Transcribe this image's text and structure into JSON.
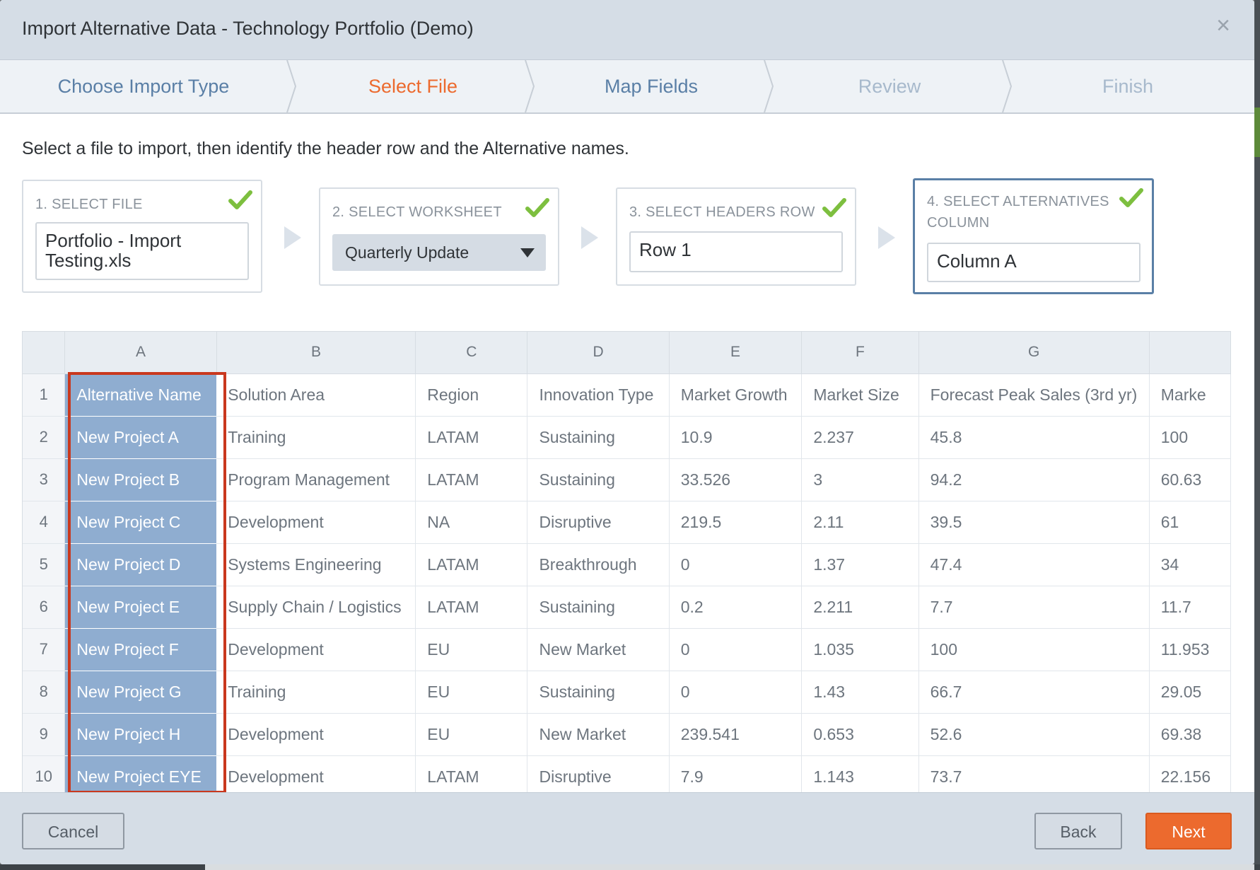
{
  "dialog": {
    "title": "Import Alternative Data - Technology Portfolio (Demo)",
    "close_glyph": "×"
  },
  "steps": [
    {
      "label": "Choose Import Type",
      "state": "done"
    },
    {
      "label": "Select File",
      "state": "active"
    },
    {
      "label": "Map Fields",
      "state": "upcoming"
    },
    {
      "label": "Review",
      "state": "disabled"
    },
    {
      "label": "Finish",
      "state": "disabled"
    }
  ],
  "instructions": "Select a file to import, then identify the header row and the Alternative names.",
  "cards": {
    "file": {
      "label": "1. SELECT FILE",
      "value": "Portfolio - Import Testing.xls"
    },
    "worksheet": {
      "label": "2. SELECT WORKSHEET",
      "value": "Quarterly Update"
    },
    "headers": {
      "label": "3. SELECT HEADERS ROW",
      "value": "Row 1"
    },
    "alternatives": {
      "label_line1": "4. SELECT ALTERNATIVES",
      "label_line2": "COLUMN",
      "value": "Column A"
    }
  },
  "grid": {
    "columns": [
      "A",
      "B",
      "C",
      "D",
      "E",
      "F",
      "G",
      ""
    ],
    "rows": [
      {
        "num": "1",
        "cells": [
          "Alternative Name",
          "Solution Area",
          "Region",
          "Innovation Type",
          "Market Growth",
          "Market Size",
          "Forecast Peak Sales (3rd yr)",
          "Marke"
        ]
      },
      {
        "num": "2",
        "cells": [
          "New Project A",
          "Training",
          "LATAM",
          "Sustaining",
          "10.9",
          "2.237",
          "45.8",
          "100"
        ]
      },
      {
        "num": "3",
        "cells": [
          "New Project B",
          "Program Management",
          "LATAM",
          "Sustaining",
          "33.526",
          "3",
          "94.2",
          "60.63"
        ]
      },
      {
        "num": "4",
        "cells": [
          "New Project C",
          "Development",
          "NA",
          "Disruptive",
          "219.5",
          "2.11",
          "39.5",
          "61"
        ]
      },
      {
        "num": "5",
        "cells": [
          "New Project D",
          "Systems Engineering",
          "LATAM",
          "Breakthrough",
          "0",
          "1.37",
          "47.4",
          "34"
        ]
      },
      {
        "num": "6",
        "cells": [
          "New Project E",
          "Supply Chain / Logistics",
          "LATAM",
          "Sustaining",
          "0.2",
          "2.211",
          "7.7",
          "11.7"
        ]
      },
      {
        "num": "7",
        "cells": [
          "New Project F",
          "Development",
          "EU",
          "New Market",
          "0",
          "1.035",
          "100",
          "11.953"
        ]
      },
      {
        "num": "8",
        "cells": [
          "New Project G",
          "Training",
          "EU",
          "Sustaining",
          "0",
          "1.43",
          "66.7",
          "29.05"
        ]
      },
      {
        "num": "9",
        "cells": [
          "New Project H",
          "Development",
          "EU",
          "New Market",
          "239.541",
          "0.653",
          "52.6",
          "69.38"
        ]
      },
      {
        "num": "10",
        "cells": [
          "New Project EYE",
          "Development",
          "LATAM",
          "Disruptive",
          "7.9",
          "1.143",
          "73.7",
          "22.156"
        ]
      }
    ]
  },
  "footer": {
    "cancel": "Cancel",
    "back": "Back",
    "next": "Next"
  },
  "colors": {
    "accent": "#ec6a2e",
    "selected_column": "#8fadd0",
    "highlight_border": "#c9381e",
    "check": "#7dbf3f"
  },
  "icons": {
    "close": "close-icon",
    "check": "checkmark-icon",
    "caret": "caret-down-icon",
    "arrow": "arrow-right-icon"
  }
}
